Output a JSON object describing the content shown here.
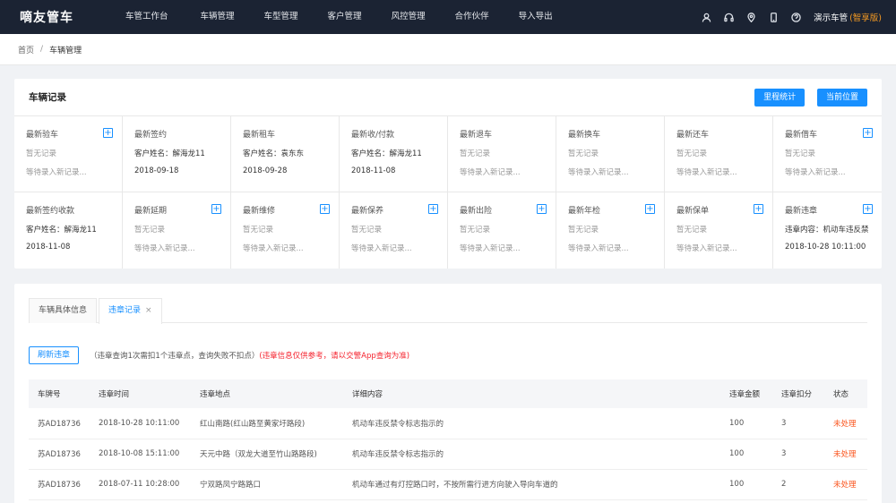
{
  "brand": "嘀友管车",
  "nav": [
    "车管工作台",
    "车辆管理",
    "车型管理",
    "客户管理",
    "风控管理",
    "合作伙伴",
    "导入导出"
  ],
  "user": {
    "name": "演示车管",
    "version": "(智享版)"
  },
  "breadcrumb": {
    "home": "首页",
    "sep": "/",
    "current": "车辆管理"
  },
  "record_card": {
    "title": "车辆记录",
    "btn_mileage": "里程统计",
    "btn_location": "当前位置",
    "cells": [
      {
        "title": "最新验车",
        "l1": "暂无记录",
        "l2": "等待录入新记录...",
        "plus": true,
        "empty": true
      },
      {
        "title": "最新签约",
        "l1": "客户姓名：解海龙11",
        "l2": "2018-09-18",
        "plus": false,
        "empty": false
      },
      {
        "title": "最新租车",
        "l1": "客户姓名：袁东东",
        "l2": "2018-09-28",
        "plus": false,
        "empty": false
      },
      {
        "title": "最新收/付款",
        "l1": "客户姓名：解海龙11",
        "l2": "2018-11-08",
        "plus": false,
        "empty": false
      },
      {
        "title": "最新退车",
        "l1": "暂无记录",
        "l2": "等待录入新记录...",
        "plus": false,
        "empty": true
      },
      {
        "title": "最新换车",
        "l1": "暂无记录",
        "l2": "等待录入新记录...",
        "plus": false,
        "empty": true
      },
      {
        "title": "最新还车",
        "l1": "暂无记录",
        "l2": "等待录入新记录...",
        "plus": false,
        "empty": true
      },
      {
        "title": "最新借车",
        "l1": "暂无记录",
        "l2": "等待录入新记录...",
        "plus": true,
        "empty": true
      },
      {
        "title": "最新签约收款",
        "l1": "客户姓名：解海龙11",
        "l2": "2018-11-08",
        "plus": false,
        "empty": false
      },
      {
        "title": "最新延期",
        "l1": "暂无记录",
        "l2": "等待录入新记录...",
        "plus": true,
        "empty": true
      },
      {
        "title": "最新维修",
        "l1": "暂无记录",
        "l2": "等待录入新记录...",
        "plus": true,
        "empty": true
      },
      {
        "title": "最新保养",
        "l1": "暂无记录",
        "l2": "等待录入新记录...",
        "plus": true,
        "empty": true
      },
      {
        "title": "最新出险",
        "l1": "暂无记录",
        "l2": "等待录入新记录...",
        "plus": true,
        "empty": true
      },
      {
        "title": "最新年检",
        "l1": "暂无记录",
        "l2": "等待录入新记录...",
        "plus": true,
        "empty": true
      },
      {
        "title": "最新保单",
        "l1": "暂无记录",
        "l2": "等待录入新记录...",
        "plus": true,
        "empty": true
      },
      {
        "title": "最新违章",
        "l1": "违章内容：机动车违反禁",
        "l2": "2018-10-28 10:11:00",
        "plus": true,
        "empty": false
      }
    ]
  },
  "tabs": {
    "info": "车辆具体信息",
    "violation": "违章记录",
    "close": "×"
  },
  "toolbar": {
    "refresh": "刷新违章",
    "note": "（违章查询1次需扣1个违章点，查询失败不扣点）",
    "warning": "(违章信息仅供参考，请以交警App查询为准)"
  },
  "table": {
    "headers": [
      "车牌号",
      "违章时间",
      "违章地点",
      "详细内容",
      "违章金额",
      "违章扣分",
      "状态"
    ],
    "rows": [
      [
        "苏AD18736",
        "2018-10-28 10:11:00",
        "红山南路(红山路至黄家圩路段)",
        "机动车违反禁令标志指示的",
        "100",
        "3",
        "未处理"
      ],
      [
        "苏AD18736",
        "2018-10-08 15:11:00",
        "天元中路（双龙大道至竹山路路段)",
        "机动车违反禁令标志指示的",
        "100",
        "3",
        "未处理"
      ],
      [
        "苏AD18736",
        "2018-07-11 10:28:00",
        "宁双路凤宁路路口",
        "机动车通过有灯控路口时，不按所需行进方向驶入导向车道的",
        "100",
        "2",
        "未处理"
      ]
    ]
  },
  "colors": {
    "primary": "#1890ff",
    "topbar": "#1b2333",
    "danger": "#f5222d",
    "status": "#fa541c",
    "version": "#f59a23"
  }
}
